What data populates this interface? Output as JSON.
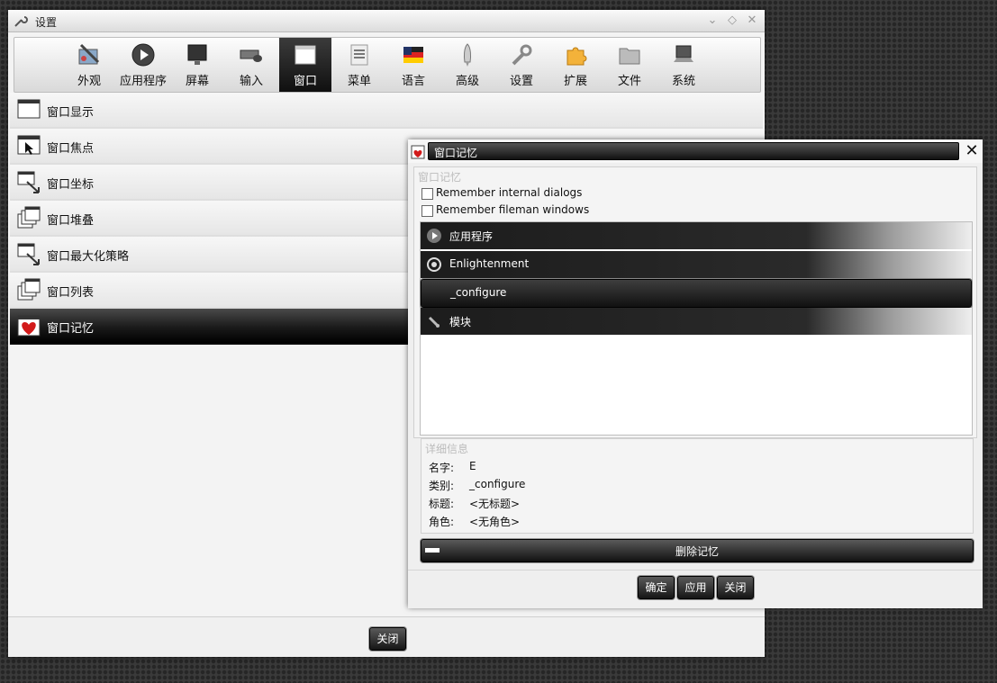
{
  "main_window": {
    "title": "设置",
    "toolbar": [
      {
        "label": "外观",
        "icon": "appearance-icon"
      },
      {
        "label": "应用程序",
        "icon": "play-icon"
      },
      {
        "label": "屏幕",
        "icon": "monitor-icon"
      },
      {
        "label": "输入",
        "icon": "keyboard-mouse-icon"
      },
      {
        "label": "窗口",
        "icon": "window-icon",
        "active": true
      },
      {
        "label": "菜单",
        "icon": "menu-icon"
      },
      {
        "label": "语言",
        "icon": "flag-icon"
      },
      {
        "label": "高级",
        "icon": "rocket-icon"
      },
      {
        "label": "设置",
        "icon": "wrench-icon"
      },
      {
        "label": "扩展",
        "icon": "puzzle-icon"
      },
      {
        "label": "文件",
        "icon": "folder-icon"
      },
      {
        "label": "系统",
        "icon": "laptop-icon"
      }
    ],
    "categories": [
      {
        "label": "窗口显示",
        "icon": "window-display-icon"
      },
      {
        "label": "窗口焦点",
        "icon": "window-focus-icon"
      },
      {
        "label": "窗口坐标",
        "icon": "window-geometry-icon"
      },
      {
        "label": "窗口堆叠",
        "icon": "window-stacking-icon"
      },
      {
        "label": "窗口最大化策略",
        "icon": "window-maximize-icon"
      },
      {
        "label": "窗口列表",
        "icon": "window-list-icon"
      },
      {
        "label": "窗口记忆",
        "icon": "heart-icon",
        "selected": true
      }
    ],
    "close_label": "关闭"
  },
  "dialog": {
    "title": "窗口记忆",
    "remember_frame_label": "窗口记忆",
    "checkboxes": [
      {
        "label": "Remember internal dialogs",
        "checked": false
      },
      {
        "label": "Remember fileman windows",
        "checked": false
      }
    ],
    "tree_items": [
      {
        "label": "应用程序",
        "icon": "play-icon"
      },
      {
        "label": "Enlightenment",
        "icon": "enlightenment-icon"
      },
      {
        "label": "_configure",
        "icon": "",
        "selected": true
      },
      {
        "label": "模块",
        "icon": "plug-icon"
      }
    ],
    "details_frame_label": "详细信息",
    "details": [
      {
        "key": "名字:",
        "value": "E"
      },
      {
        "key": "类别:",
        "value": "_configure"
      },
      {
        "key": "标题:",
        "value": "<无标题>"
      },
      {
        "key": "角色:",
        "value": "<无角色>"
      }
    ],
    "delete_label": "删除记忆",
    "buttons": {
      "ok": "确定",
      "apply": "应用",
      "close": "关闭"
    }
  }
}
